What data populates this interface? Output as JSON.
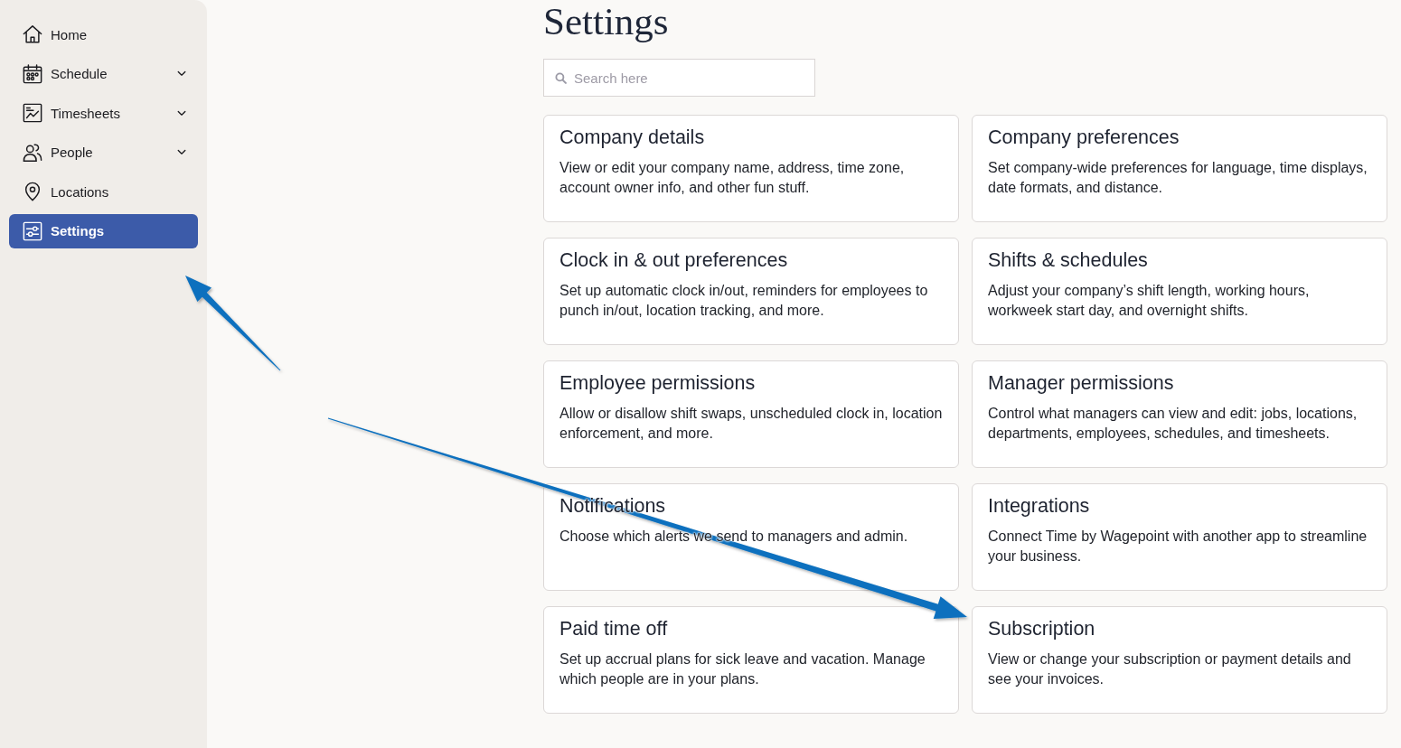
{
  "sidebar": {
    "items": [
      {
        "label": "Home",
        "has_submenu": false,
        "selected": false
      },
      {
        "label": "Schedule",
        "has_submenu": true,
        "selected": false
      },
      {
        "label": "Timesheets",
        "has_submenu": true,
        "selected": false
      },
      {
        "label": "People",
        "has_submenu": true,
        "selected": false
      },
      {
        "label": "Locations",
        "has_submenu": false,
        "selected": false
      },
      {
        "label": "Settings",
        "has_submenu": false,
        "selected": true
      }
    ]
  },
  "page": {
    "title": "Settings"
  },
  "search": {
    "placeholder": "Search here"
  },
  "cards": [
    {
      "title": "Company details",
      "description": "View or edit your company name, address, time zone, account owner info, and other fun stuff."
    },
    {
      "title": "Company preferences",
      "description": "Set company-wide preferences for language, time displays, date formats, and distance."
    },
    {
      "title": "Clock in & out preferences",
      "description": "Set up automatic clock in/out, reminders for employees to punch in/out, location tracking, and more."
    },
    {
      "title": "Shifts & schedules",
      "description": "Adjust your company’s shift length, working hours, workweek start day, and overnight shifts."
    },
    {
      "title": "Employee permissions",
      "description": "Allow or disallow shift swaps, unscheduled clock in, location enforcement, and more."
    },
    {
      "title": "Manager permissions",
      "description": "Control what managers can view and edit: jobs, locations, departments, employees, schedules, and timesheets."
    },
    {
      "title": "Notifications",
      "description": "Choose which alerts we send to managers and admin."
    },
    {
      "title": "Integrations",
      "description": "Connect Time by Wagepoint with another app to streamline your business."
    },
    {
      "title": "Paid time off",
      "description": "Set up accrual plans for sick leave and vacation. Manage which people are in your plans."
    },
    {
      "title": "Subscription",
      "description": "View or change your subscription or payment details and see your invoices."
    }
  ]
}
